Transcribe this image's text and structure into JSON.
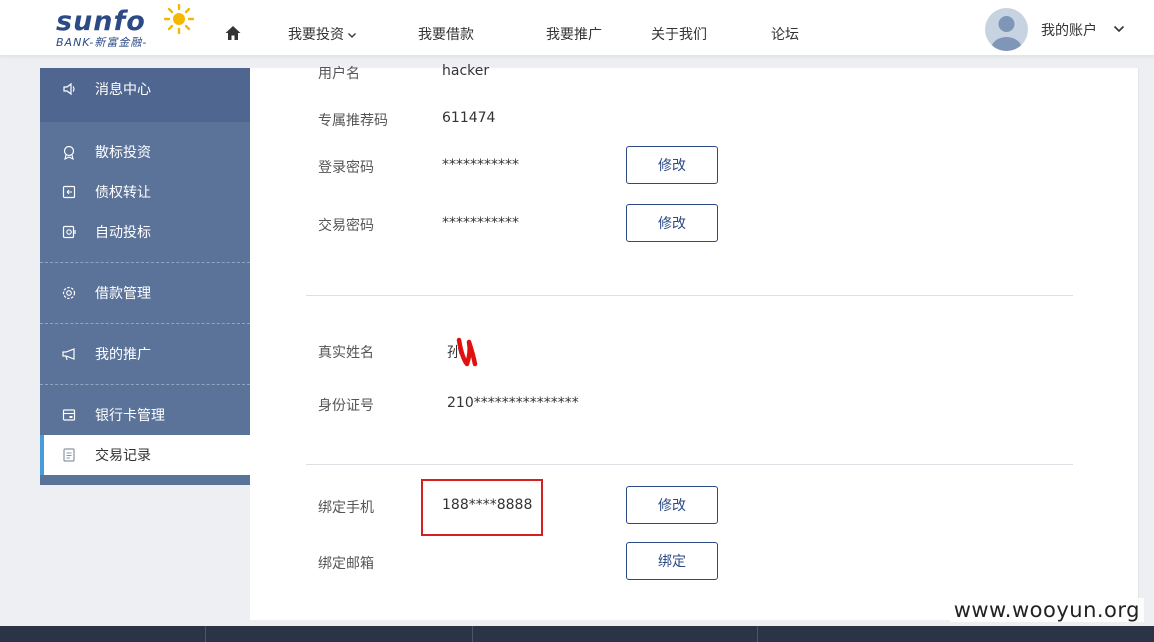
{
  "logo": {
    "name": "sunfo",
    "tagline": "BANK-新富金融-"
  },
  "nav": {
    "items": [
      "我要投资",
      "我要借款",
      "我要推广",
      "关于我们",
      "论坛"
    ],
    "account_label": "我的账户"
  },
  "sidebar": {
    "top_item": "消息中心",
    "items": [
      "散标投资",
      "债权转让",
      "自动投标",
      "借款管理",
      "我的推广",
      "银行卡管理",
      "交易记录"
    ],
    "active_item": "交易记录"
  },
  "account_info": {
    "username_label": "用户名",
    "username": "hacker",
    "referral_label": "专属推荐码",
    "referral_code": "611474",
    "login_password_label": "登录密码",
    "login_password": "***********",
    "trade_password_label": "交易密码",
    "trade_password": "***********",
    "modify_label": "修改",
    "real_name_label": "真实姓名",
    "real_name": "孙",
    "id_number_label": "身份证号",
    "id_number": "210***************",
    "phone_label": "绑定手机",
    "phone": "188****8888",
    "email_label": "绑定邮箱",
    "bind_label": "绑定"
  },
  "watermark": "www.wooyun.org",
  "colors": {
    "brand": "#2c4a86",
    "sidebar": "#5b7399",
    "sidebar_top": "#4f6790",
    "highlight": "#d42020",
    "active_bar": "#4a9bdc"
  }
}
